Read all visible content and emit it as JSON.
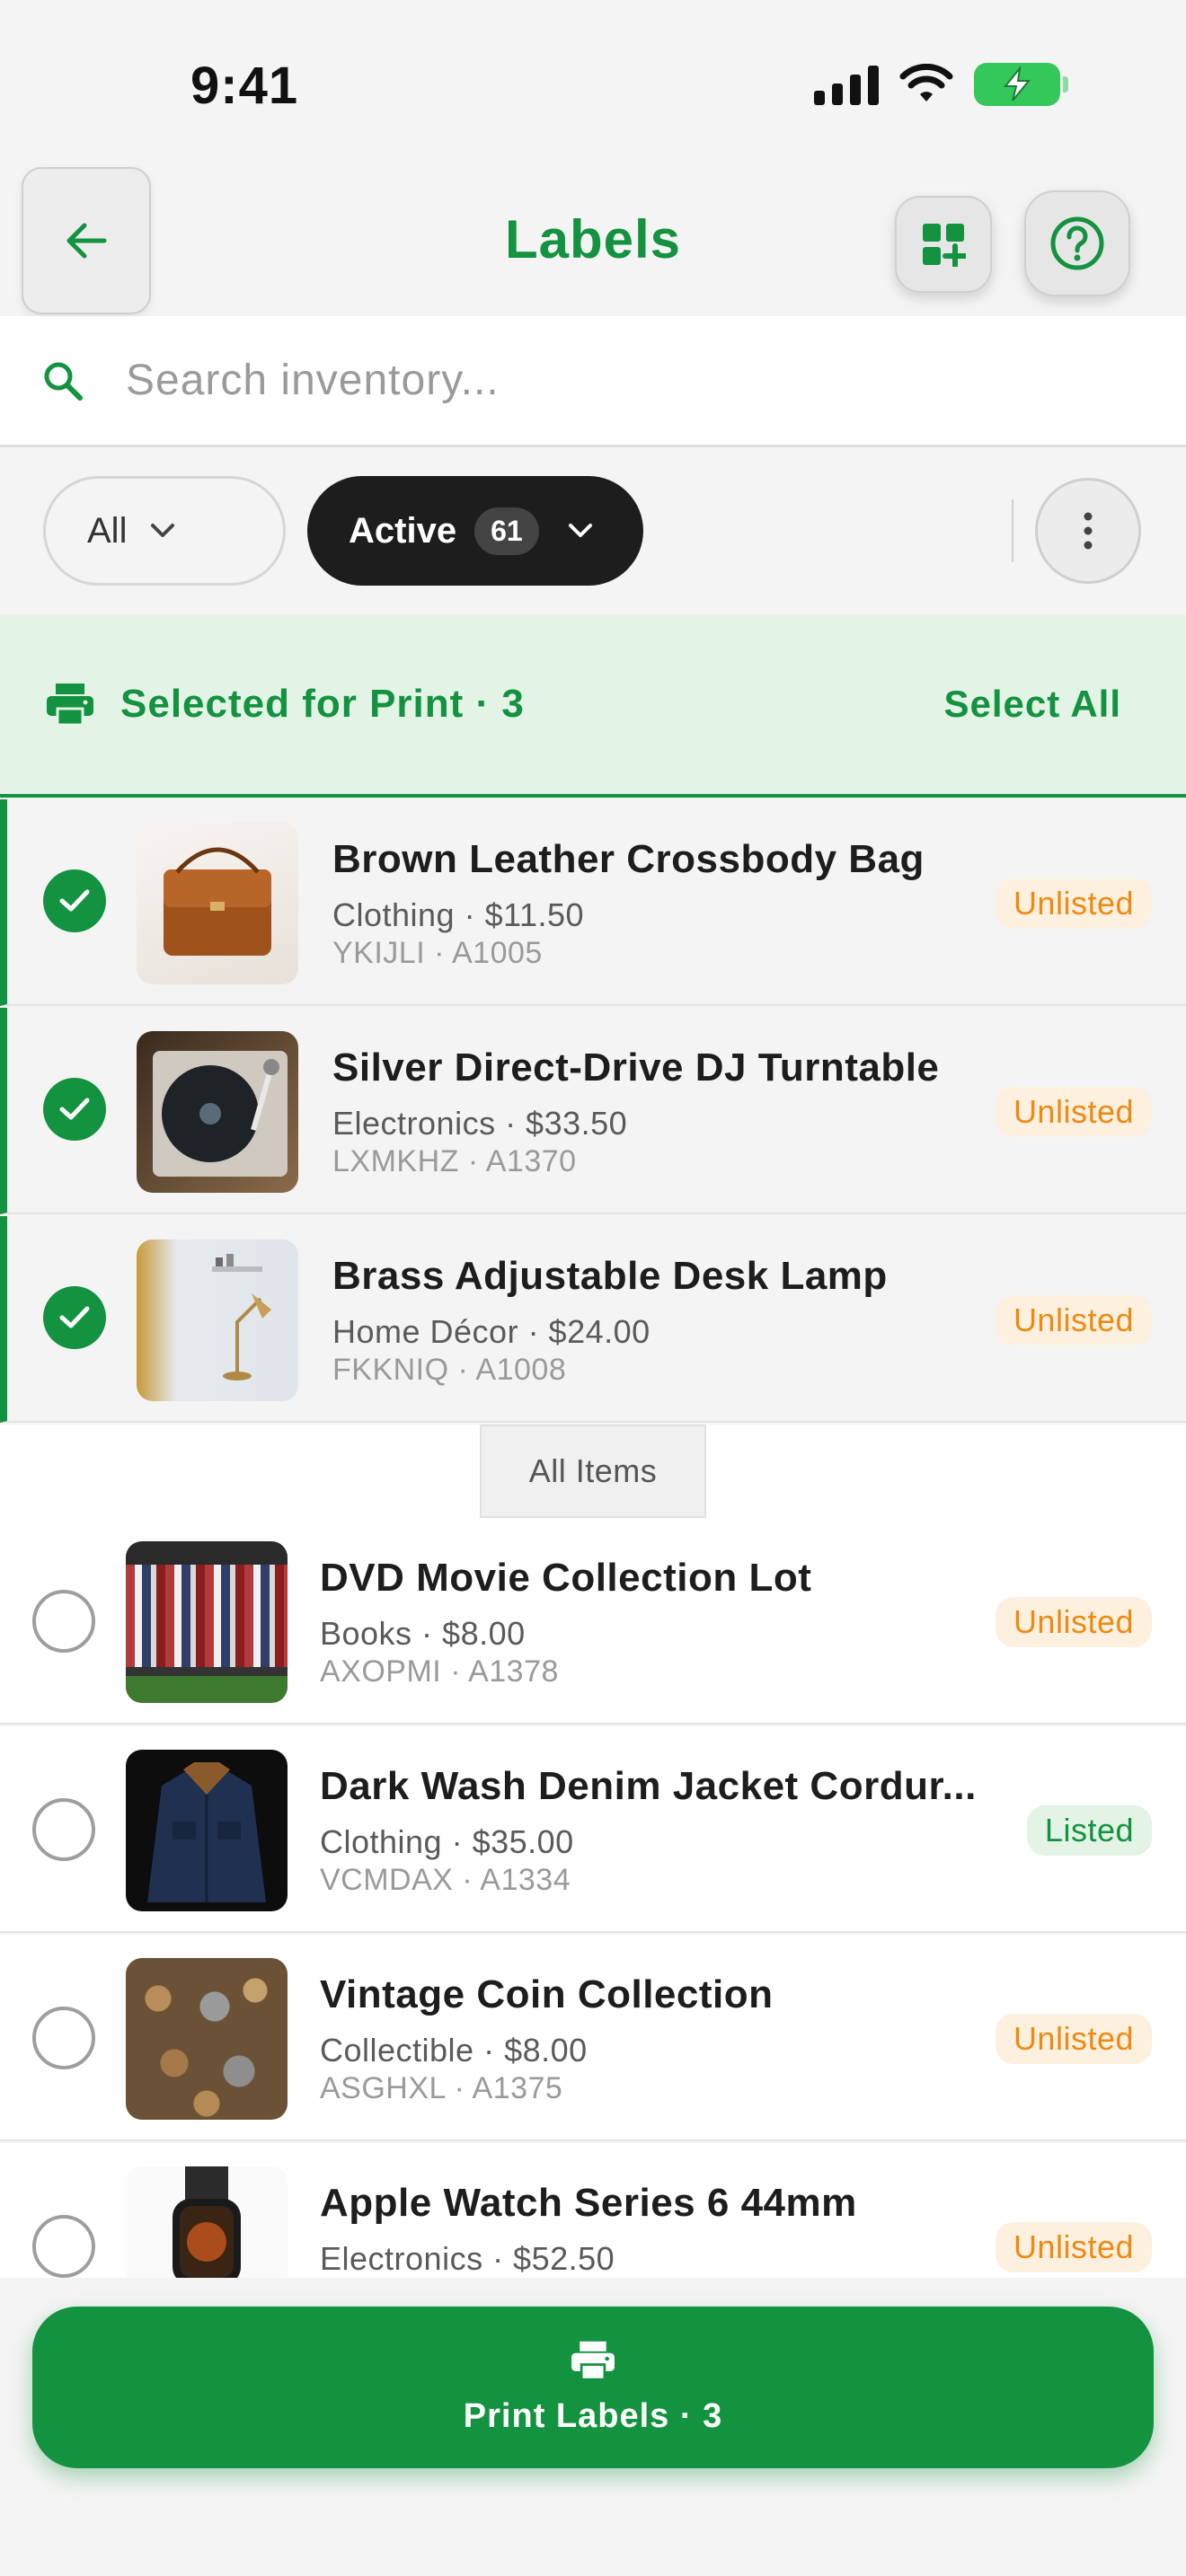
{
  "status_bar": {
    "time": "9:41"
  },
  "header": {
    "title": "Labels"
  },
  "search": {
    "placeholder": "Search inventory..."
  },
  "filters": {
    "all_label": "All",
    "active_label": "Active",
    "active_count": "61"
  },
  "selection": {
    "label": "Selected for Print · 3",
    "select_all": "Select All"
  },
  "selected_items": [
    {
      "title": "Brown Leather Crossbody Bag",
      "subtitle": "Clothing · $11.50",
      "sku": "YKIJLI · A1005",
      "status": "Unlisted"
    },
    {
      "title": "Silver Direct-Drive DJ Turntable",
      "subtitle": "Electronics · $33.50",
      "sku": "LXMKHZ · A1370",
      "status": "Unlisted"
    },
    {
      "title": "Brass Adjustable Desk Lamp",
      "subtitle": "Home Décor · $24.00",
      "sku": "FKKNIQ · A1008",
      "status": "Unlisted"
    }
  ],
  "section_label": "All Items",
  "all_items": [
    {
      "title": "DVD Movie Collection Lot",
      "subtitle": "Books · $8.00",
      "sku": "AXOPMI · A1378",
      "status": "Unlisted"
    },
    {
      "title": "Dark Wash Denim Jacket Cordur...",
      "subtitle": "Clothing · $35.00",
      "sku": "VCMDAX · A1334",
      "status": "Listed"
    },
    {
      "title": "Vintage Coin Collection",
      "subtitle": "Collectible · $8.00",
      "sku": "ASGHXL · A1375",
      "status": "Unlisted"
    },
    {
      "title": "Apple Watch Series 6 44mm",
      "subtitle": "Electronics · $52.50",
      "sku": "",
      "status": "Unlisted"
    }
  ],
  "print_button": {
    "label": "Print Labels · 3"
  },
  "colors": {
    "accent": "#13923f",
    "selected_bg": "#e3f3e6",
    "unlisted_text": "#ee8a12",
    "unlisted_bg": "#fdf0df",
    "chip_dark": "#1d1d1d"
  },
  "icons": {
    "back": "arrow-left-icon",
    "grid_add": "grid-plus-icon",
    "help": "help-circle-icon",
    "search": "search-icon",
    "chevron": "chevron-down-icon",
    "more": "more-vertical-icon",
    "printer": "printer-icon",
    "check": "check-icon"
  }
}
